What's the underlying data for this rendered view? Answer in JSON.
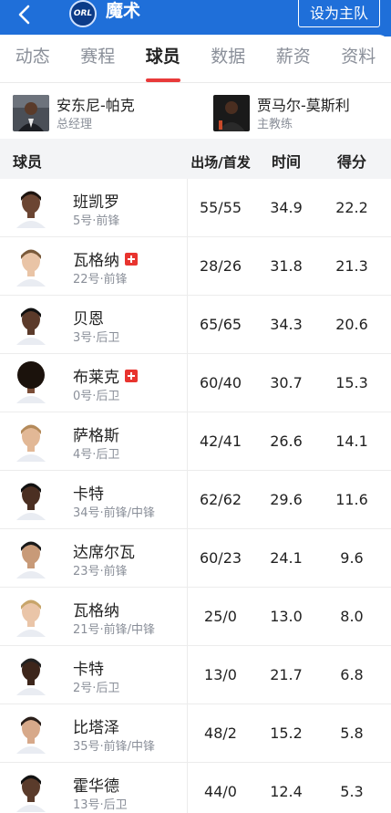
{
  "header": {
    "team_name": "魔术",
    "logo_text": "ORL",
    "set_home_label": "设为主队",
    "colors": {
      "bar": "#1f6fd9",
      "accent": "#e83a3a"
    }
  },
  "tabs": [
    {
      "label": "动态"
    },
    {
      "label": "赛程"
    },
    {
      "label": "球员"
    },
    {
      "label": "数据"
    },
    {
      "label": "薪资"
    },
    {
      "label": "资料"
    }
  ],
  "active_tab": "球员",
  "staff": [
    {
      "name": "安东尼-帕克",
      "role": "总经理"
    },
    {
      "name": "贾马尔-莫斯利",
      "role": "主教练"
    }
  ],
  "table": {
    "headers": {
      "player": "球员",
      "gp": "出场/首发",
      "min": "时间",
      "pts": "得分"
    },
    "rows": [
      {
        "name": "班凯罗",
        "info": "5号·前锋",
        "gp": "55/55",
        "min": "34.9",
        "pts": "22.2",
        "injured": false
      },
      {
        "name": "瓦格纳",
        "info": "22号·前锋",
        "gp": "28/26",
        "min": "31.8",
        "pts": "21.3",
        "injured": true
      },
      {
        "name": "贝恩",
        "info": "3号·后卫",
        "gp": "65/65",
        "min": "34.3",
        "pts": "20.6",
        "injured": false
      },
      {
        "name": "布莱克",
        "info": "0号·后卫",
        "gp": "60/40",
        "min": "30.7",
        "pts": "15.3",
        "injured": true
      },
      {
        "name": "萨格斯",
        "info": "4号·后卫",
        "gp": "42/41",
        "min": "26.6",
        "pts": "14.1",
        "injured": false
      },
      {
        "name": "卡特",
        "info": "34号·前锋/中锋",
        "gp": "62/62",
        "min": "29.6",
        "pts": "11.6",
        "injured": false
      },
      {
        "name": "达席尔瓦",
        "info": "23号·前锋",
        "gp": "60/23",
        "min": "24.1",
        "pts": "9.6",
        "injured": false
      },
      {
        "name": "瓦格纳",
        "info": "21号·前锋/中锋",
        "gp": "25/0",
        "min": "13.0",
        "pts": "8.0",
        "injured": false
      },
      {
        "name": "卡特",
        "info": "2号·后卫",
        "gp": "13/0",
        "min": "21.7",
        "pts": "6.8",
        "injured": false
      },
      {
        "name": "比塔泽",
        "info": "35号·前锋/中锋",
        "gp": "48/2",
        "min": "15.2",
        "pts": "5.8",
        "injured": false
      },
      {
        "name": "霍华德",
        "info": "13号·后卫",
        "gp": "44/0",
        "min": "12.4",
        "pts": "5.3",
        "injured": false
      }
    ]
  }
}
